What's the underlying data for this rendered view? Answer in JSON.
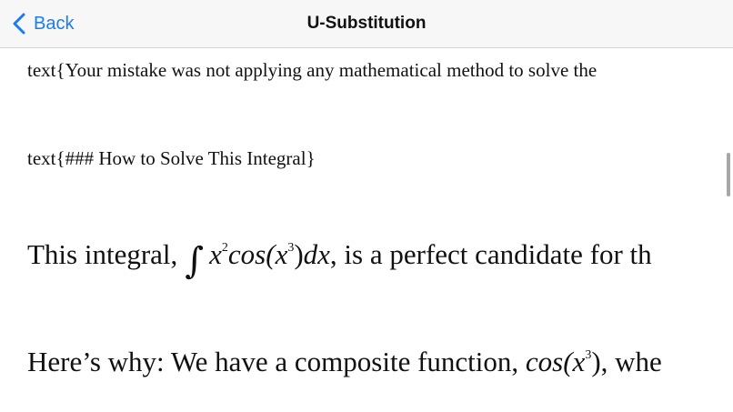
{
  "nav": {
    "back_label": "Back",
    "title": "U-Substitution",
    "accent_color": "#1a7cf5",
    "back_icon": "chevron-left-icon"
  },
  "content": {
    "line1": "text{Your mistake was not applying any mathematical method to solve the",
    "line2": "text{### How to Solve This Integral}",
    "para1": {
      "before": "This integral,",
      "math_x": "x",
      "math_exp2": "2",
      "math_cos_open": "cos(",
      "math_x2": "x",
      "math_exp3": "3",
      "math_close": ")",
      "math_dx": "dx",
      "after": ", is a perfect candidate for th"
    },
    "para2": {
      "before": "Here’s why: We have a composite function, ",
      "math_cos_open": "cos(",
      "math_x": "x",
      "math_exp3": "3",
      "math_close": ")",
      "after": ", whe"
    }
  }
}
